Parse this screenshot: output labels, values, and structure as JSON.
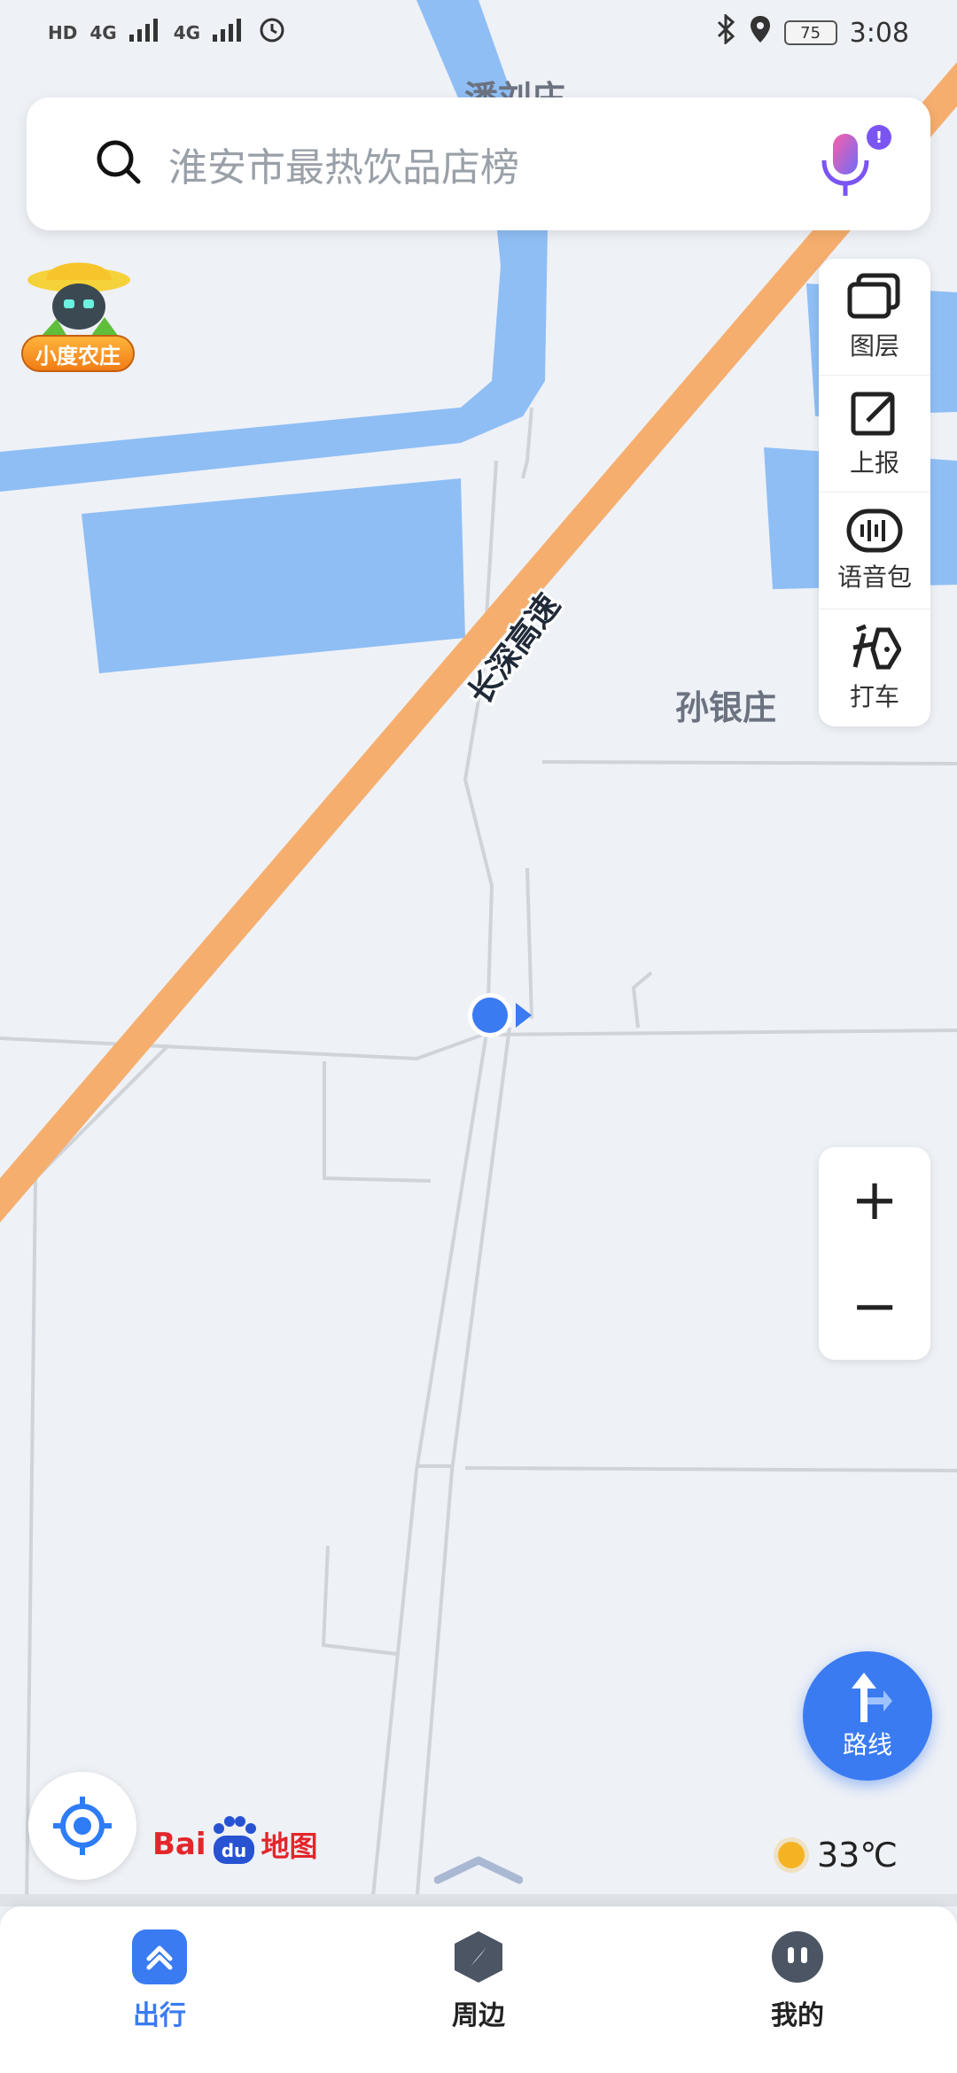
{
  "status_bar": {
    "time": "3:08",
    "battery": "75",
    "network_1": "4G",
    "network_2": "4G",
    "hd": "HD"
  },
  "search": {
    "placeholder": "淮安市最热饮品店榜"
  },
  "farm_badge": {
    "label": "小度农庄"
  },
  "tools": [
    {
      "label": "图层",
      "icon": "layers-icon"
    },
    {
      "label": "上报",
      "icon": "edit-report-icon"
    },
    {
      "label": "语音包",
      "icon": "voice-pack-icon"
    },
    {
      "label": "打车",
      "icon": "taxi-icon"
    }
  ],
  "zoom": {
    "plus": "+",
    "minus": "−"
  },
  "route": {
    "label": "路线"
  },
  "logo": {
    "bai": "Bai",
    "du": "du",
    "map": "地图"
  },
  "weather": {
    "temp": "33℃"
  },
  "map_labels": {
    "village_1": "潘刘庄",
    "village_2": "孙银庄",
    "highway": "长深高速"
  },
  "nav": [
    {
      "label": "出行",
      "icon": "travel-icon",
      "active": true
    },
    {
      "label": "周边",
      "icon": "nearby-compass-icon",
      "active": false
    },
    {
      "label": "我的",
      "icon": "profile-icon",
      "active": false
    }
  ],
  "colors": {
    "accent": "#3a7bf2",
    "highway": "#f6ae6e",
    "water": "#8fbef5",
    "map_bg": "#eef1f6"
  }
}
